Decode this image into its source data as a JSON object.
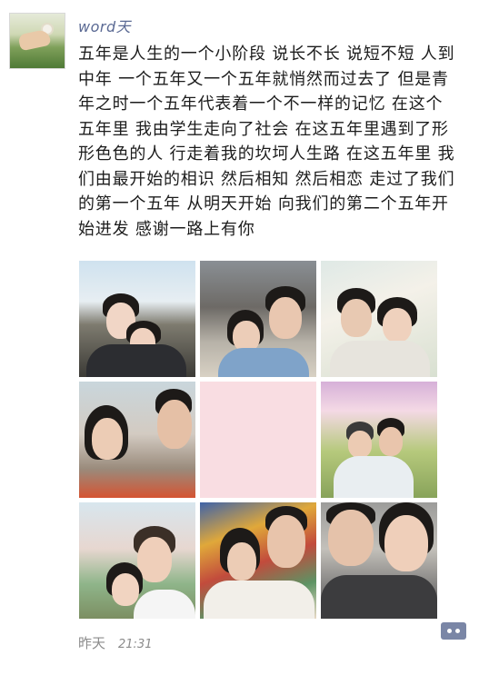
{
  "post": {
    "username": "word天",
    "text": "五年是人生的一个小阶段 说长不长 说短不短 人到中年 一个五年又一个五年就悄然而过去了 但是青年之时一个五年代表着一个不一样的记忆 在这个五年里 我由学生走向了社会 在这五年里遇到了形形色色的人 行走着我的坎坷人生路 在这五年里 我们由最开始的相识 然后相知 然后相恋 走过了我们的第一个五年 从明天开始 向我们的第二个五年开始进发 感谢一路上有你",
    "time_day": "昨天",
    "time_clock": "21:31"
  },
  "photos": [
    {
      "id": "photo-1"
    },
    {
      "id": "photo-2"
    },
    {
      "id": "photo-3"
    },
    {
      "id": "photo-4"
    },
    {
      "id": "photo-5"
    },
    {
      "id": "photo-6"
    },
    {
      "id": "photo-7"
    },
    {
      "id": "photo-8"
    },
    {
      "id": "photo-9"
    }
  ],
  "colors": {
    "username": "#5b6a94",
    "comment_button": "#7a86a6",
    "timestamp": "#8b8b8b"
  },
  "icons": {
    "comment": "more-comment-icon"
  }
}
